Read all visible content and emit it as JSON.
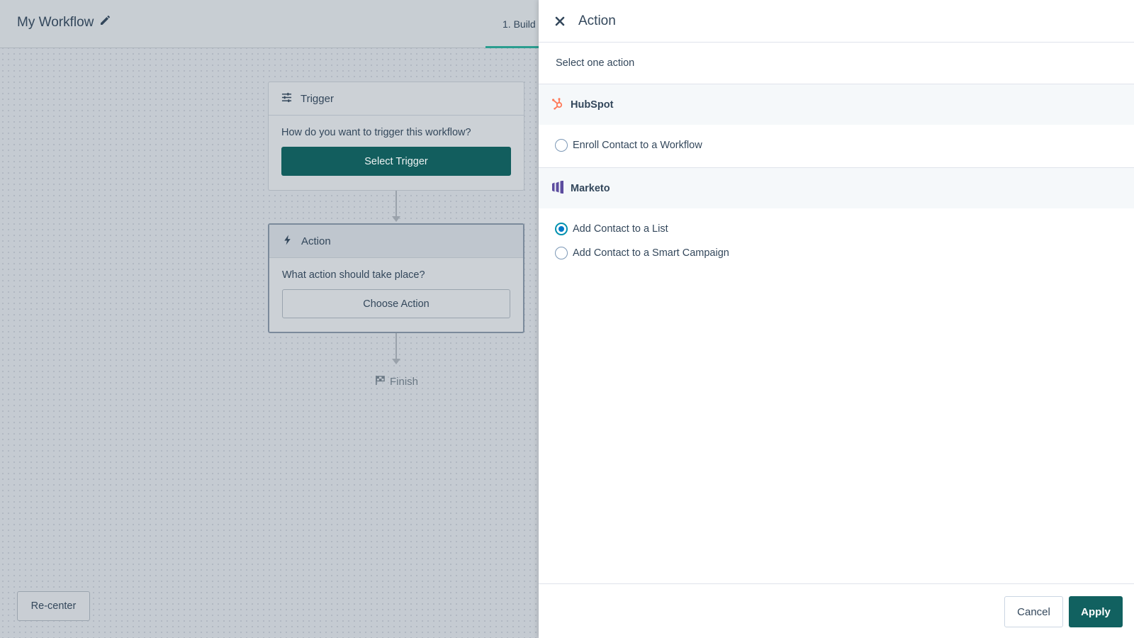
{
  "workflow": {
    "title": "My Workflow",
    "step_tab": "1. Build"
  },
  "canvas": {
    "trigger_node": {
      "title": "Trigger",
      "question": "How do you want to trigger this workflow?",
      "button_label": "Select Trigger"
    },
    "action_node": {
      "title": "Action",
      "question": "What action should take place?",
      "button_label": "Choose Action"
    },
    "finish_label": "Finish",
    "recenter_label": "Re-center"
  },
  "panel": {
    "title": "Action",
    "section_label": "Select one action",
    "groups": [
      {
        "name": "HubSpot",
        "icon": "hubspot-logo-icon",
        "options": [
          {
            "label": "Enroll Contact to a Workflow",
            "selected": false
          }
        ]
      },
      {
        "name": "Marketo",
        "icon": "marketo-logo-icon",
        "options": [
          {
            "label": "Add Contact to a List",
            "selected": true
          },
          {
            "label": "Add Contact to a Smart Campaign",
            "selected": false
          }
        ]
      }
    ],
    "cancel_label": "Cancel",
    "apply_label": "Apply"
  },
  "colors": {
    "primary_teal": "#116160",
    "radio_selected": "#0078c8",
    "hubspot_orange": "#ff7a59",
    "marketo_purple": "#5c4c9f"
  }
}
